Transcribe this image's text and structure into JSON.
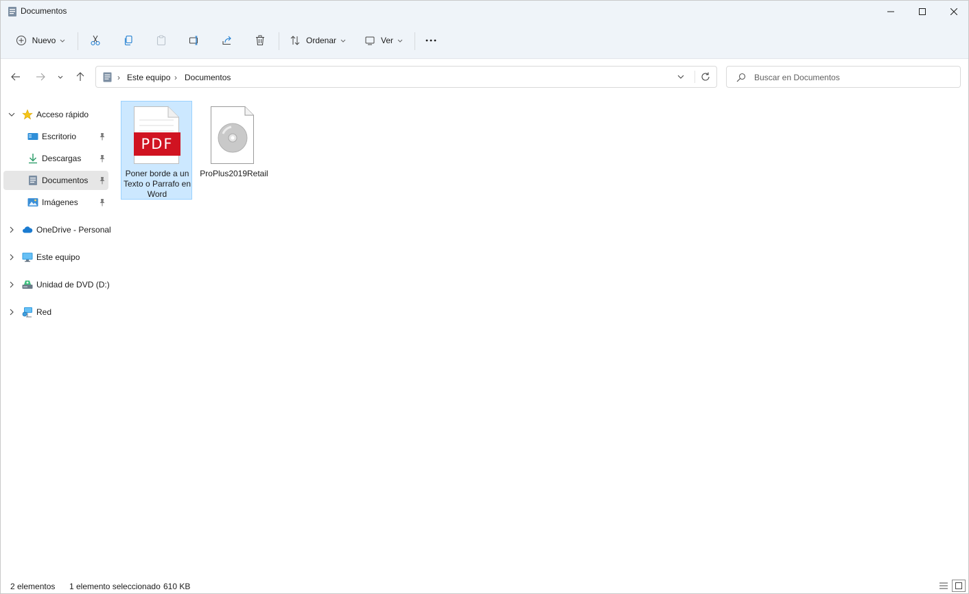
{
  "window": {
    "title": "Documentos"
  },
  "toolbar": {
    "new_label": "Nuevo",
    "sort_label": "Ordenar",
    "view_label": "Ver",
    "more_label": "···"
  },
  "address": {
    "crumbs": [
      "Este equipo",
      "Documentos"
    ],
    "separator": "›"
  },
  "search": {
    "placeholder": "Buscar en Documentos"
  },
  "sidebar": {
    "quick_access": {
      "label": "Acceso rápido",
      "items": [
        {
          "label": "Escritorio",
          "icon": "desktop-icon",
          "pinned": true
        },
        {
          "label": "Descargas",
          "icon": "download-icon",
          "pinned": true
        },
        {
          "label": "Documentos",
          "icon": "documents-icon",
          "pinned": true,
          "selected": true
        },
        {
          "label": "Imágenes",
          "icon": "pictures-icon",
          "pinned": true
        }
      ]
    },
    "roots": [
      {
        "label": "OneDrive - Personal",
        "icon": "cloud-icon"
      },
      {
        "label": "Este equipo",
        "icon": "computer-icon"
      },
      {
        "label": "Unidad de DVD (D:)",
        "icon": "dvd-drive-icon"
      },
      {
        "label": "Red",
        "icon": "network-icon"
      }
    ]
  },
  "files": [
    {
      "name": "Poner borde a un Texto o Parrafo en Word",
      "type": "pdf",
      "icon_text": "PDF",
      "selected": true
    },
    {
      "name": "ProPlus2019Retail",
      "type": "disc-image",
      "selected": false
    }
  ],
  "status": {
    "count": "2 elementos",
    "selection": "1 elemento seleccionado",
    "size": "610 KB"
  },
  "colors": {
    "accent": "#0067c0",
    "selected_tile": "#cce8ff",
    "selected_border": "#99d1ff",
    "pdf_red": "#d01321",
    "toolbar_bg": "#eff4f9"
  }
}
